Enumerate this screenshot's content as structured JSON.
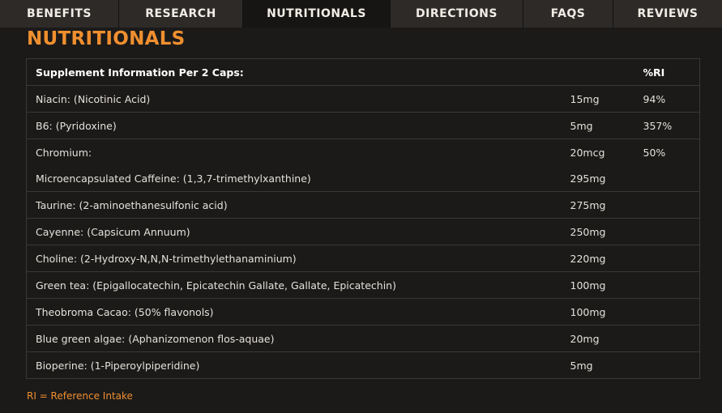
{
  "tabs": [
    {
      "label": "BENEFITS",
      "active": false
    },
    {
      "label": "RESEARCH",
      "active": false
    },
    {
      "label": "NUTRITIONALS",
      "active": true
    },
    {
      "label": "DIRECTIONS",
      "active": false
    },
    {
      "label": "FAQS",
      "active": false
    },
    {
      "label": "REVIEWS",
      "active": false
    }
  ],
  "heading": "NUTRITIONALS",
  "table": {
    "header": {
      "label": "Supplement Information Per 2 Caps:",
      "amount": "",
      "ri": "%RI"
    },
    "rows": [
      {
        "ingredient": "Niacin: (Nicotinic Acid)",
        "amount": "15mg",
        "ri": "94%"
      },
      {
        "ingredient": "B6: (Pyridoxine)",
        "amount": "5mg",
        "ri": "357%"
      },
      {
        "ingredient": "Chromium:",
        "amount": "20mcg",
        "ri": "50%"
      },
      {
        "ingredient": "Microencapsulated Caffeine: (1,3,7-trimethylxanthine)",
        "amount": "295mg",
        "ri": ""
      },
      {
        "ingredient": "Taurine: (2-aminoethanesulfonic acid)",
        "amount": "275mg",
        "ri": ""
      },
      {
        "ingredient": "Cayenne: (Capsicum Annuum)",
        "amount": "250mg",
        "ri": ""
      },
      {
        "ingredient": "Choline: (2-Hydroxy-N,N,N-trimethylethanaminium)",
        "amount": "220mg",
        "ri": ""
      },
      {
        "ingredient": "Green tea: (Epigallocatechin, Epicatechin Gallate, Gallate, Epicatechin)",
        "amount": "100mg",
        "ri": ""
      },
      {
        "ingredient": "Theobroma Cacao: (50% flavonols)",
        "amount": "100mg",
        "ri": ""
      },
      {
        "ingredient": "Blue green algae: (Aphanizomenon flos-aquae)",
        "amount": "20mg",
        "ri": ""
      },
      {
        "ingredient": "Bioperine: (1-Piperoylpiperidine)",
        "amount": "5mg",
        "ri": ""
      }
    ]
  },
  "footnote": "RI = Reference Intake",
  "colors": {
    "accent": "#f08f2f",
    "background": "#1b1a19",
    "tab_bg": "#2d2a28",
    "tab_active_bg": "#161514",
    "border": "#3a3835"
  }
}
